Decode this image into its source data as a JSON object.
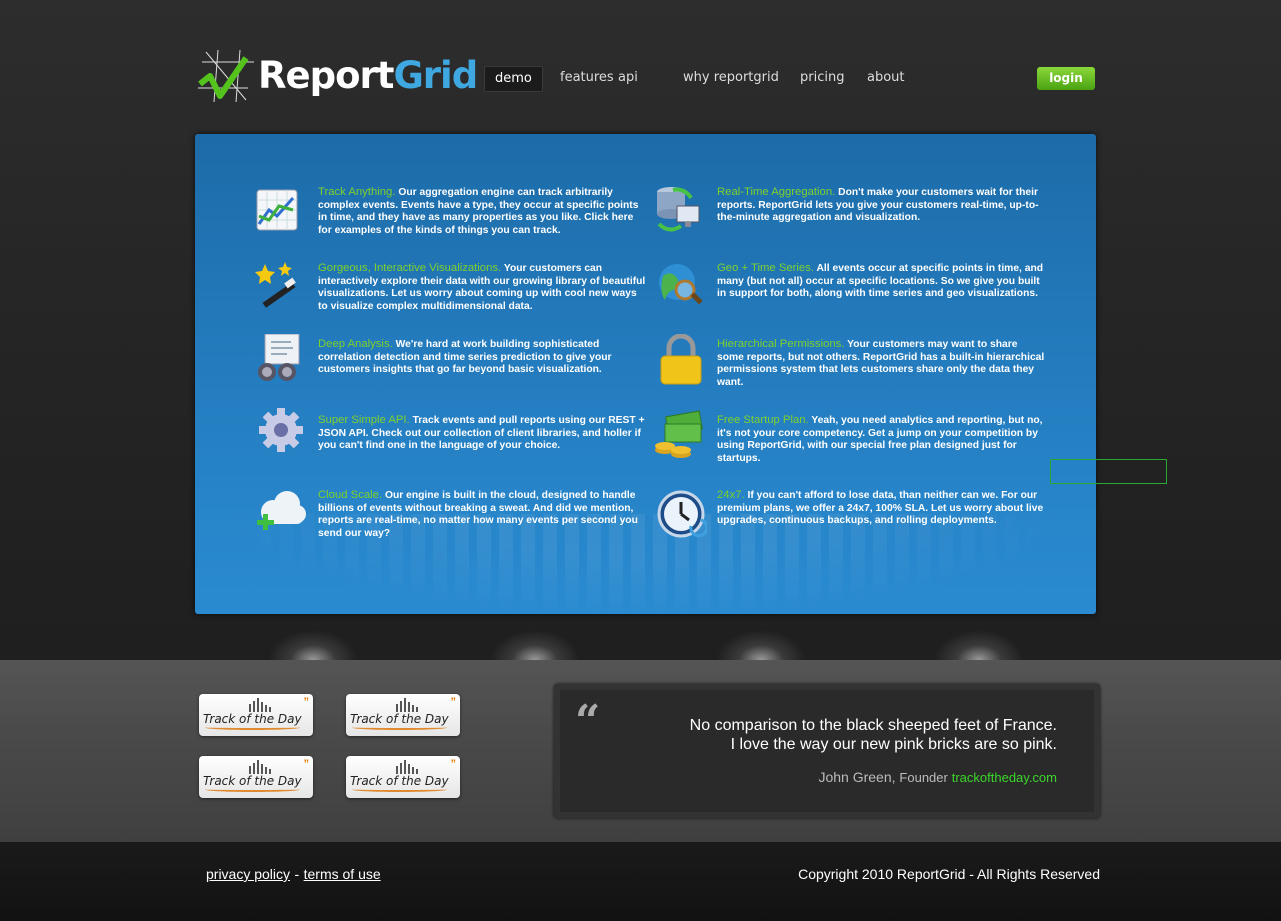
{
  "header": {
    "brand": {
      "first": "Report",
      "second": "Grid"
    },
    "nav": [
      {
        "label": "demo",
        "active": true
      },
      {
        "label": "features"
      },
      {
        "label": "api"
      },
      {
        "label": "why reportgrid"
      },
      {
        "label": "pricing"
      },
      {
        "label": "about"
      }
    ],
    "login_label": "login"
  },
  "features": [
    {
      "title": "Track Anything.",
      "body": "Our aggregation engine can track arbitrarily complex events. Events have a type, they occur at specific points in time, and they have as many properties as you like. Click here for examples of the kinds of things you can track.",
      "icon": "chart-icon"
    },
    {
      "title": "Real-Time Aggregation.",
      "body": "Don't make your customers wait for their reports. ReportGrid lets you give your customers real-time, up-to-the-minute aggregation and visualization.",
      "icon": "database-sync-icon"
    },
    {
      "title": "Gorgeous, Interactive Visualizations.",
      "body": "Your customers can interactively explore their data with our growing library of beautiful visualizations. Let us worry about coming up with cool new ways to visualize complex multidimensional data.",
      "icon": "magic-wand-icon"
    },
    {
      "title": "Geo + Time Series.",
      "body": "All events occur at specific points in time, and many (but not all) occur at specific locations. So we give you built in support for both, along with time series and geo visualizations.",
      "icon": "globe-search-icon"
    },
    {
      "title": "Deep Analysis.",
      "body": "We're hard at work building sophisticated correlation detection and time series prediction to give your customers insights that go far beyond basic visualization.",
      "icon": "binoculars-icon"
    },
    {
      "title": "Hierarchical Permissions.",
      "body": "Your customers may want to share some reports, but not others. ReportGrid has a built-in hierarchical permissions system that lets customers share only the data they want.",
      "icon": "padlock-icon"
    },
    {
      "title": "Super Simple API.",
      "body": "Track events and pull reports using our REST + JSON API. Check out our collection of client libraries, and holler if you can't find one in the language of your choice.",
      "icon": "gear-icon"
    },
    {
      "title": "Free Startup Plan.",
      "body": "Yeah, you need analytics and reporting, but no, it's not your core competency. Get a jump on your competition by using ReportGrid, with our special free plan designed just for startups.",
      "icon": "money-icon"
    },
    {
      "title": "Cloud Scale.",
      "body": "Our engine is built in the cloud, designed to handle billions of events without breaking a sweat. And did we mention, reports are real-time, no matter how many events per second you send our way?",
      "icon": "cloud-add-icon"
    },
    {
      "title": "24x7.",
      "body": "If you can't afford to lose data, than neither can we. For our premium plans, we offer a 24x7, 100% SLA. Let us worry about live upgrades, continuous backups, and rolling deployments.",
      "icon": "clock-icon"
    }
  ],
  "clients": [
    {
      "logo_text": "Track of the Day"
    },
    {
      "logo_text": "Track of the Day"
    },
    {
      "logo_text": "Track of the Day"
    },
    {
      "logo_text": "Track of the Day"
    }
  ],
  "testimonial": {
    "mark": "“",
    "line1": "No comparison to the black sheeped feet of France.",
    "line2": "I love the way our new pink bricks are so pink.",
    "author": "John Green,",
    "role": "Founder",
    "site": "trackoftheday.com"
  },
  "footer": {
    "privacy": "privacy policy",
    "separator": "-",
    "terms": "terms of use",
    "copyright": "Copyright 2010 ReportGrid - All Rights Reserved"
  },
  "colors": {
    "accent_green": "#7ed12c",
    "brand_blue": "#3fa8e0",
    "panel_blue": "#237bbd",
    "link_green": "#3bd62a"
  }
}
